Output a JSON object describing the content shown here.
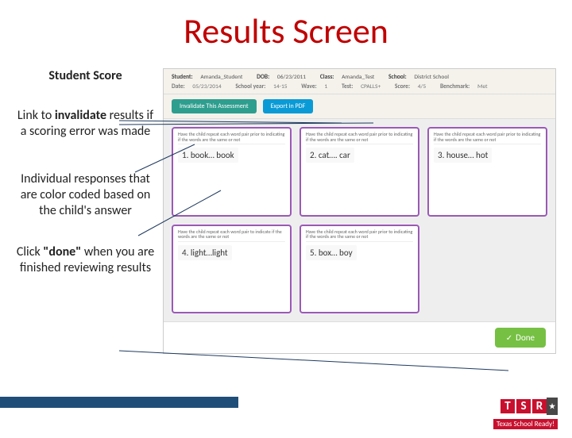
{
  "title": "Results Screen",
  "annotations": {
    "heading": "Student Score",
    "a2_line1": "Link to ",
    "a2_bold": "invalidate",
    "a2_line2": " results if a scoring error was made",
    "a3": "Individual responses that are color coded based on the child's answer",
    "a4_pre": "Click ",
    "a4_bold": "\"done\"",
    "a4_post": " when you are finished reviewing results"
  },
  "app": {
    "header": {
      "student_label": "Student:",
      "student": "Amanda_Student",
      "dob_label": "DOB:",
      "dob": "06/23/2011",
      "class_label": "Class:",
      "class": "Amanda_Test",
      "school_label": "School:",
      "school": "District School",
      "date_label": "Date:",
      "date": "05/23/2014",
      "sy_label": "School year:",
      "sy": "14-15",
      "wave_label": "Wave:",
      "wave": "1",
      "test_label": "Test:",
      "test": "CPALLS+",
      "score_label": "Score:",
      "score": "4/5",
      "bench_label": "Benchmark:",
      "bench": "Met"
    },
    "buttons": {
      "invalidate": "Invalidate This Assessment",
      "export": "Export in PDF",
      "done": "Done"
    },
    "cards": [
      {
        "prompt": "Have the child repeat each word pair prior to indicating if the words are the same or not",
        "answer": "1. book… book"
      },
      {
        "prompt": "Have the child repeat each word pair prior to indicating if the words are the same or not",
        "answer": "2. cat…. car"
      },
      {
        "prompt": "Have the child repeat each word pair prior to indicating if the words are the same or not",
        "answer": "3. house… hot"
      },
      {
        "prompt": "Have the child repeat each word pair to indicate if the words are the same or not",
        "answer": "4. light…light"
      },
      {
        "prompt": "Have the child repeat each word pair prior to indicating if the words are the same or not",
        "answer": "5. box… boy"
      }
    ]
  },
  "brand": {
    "t": "T",
    "s": "S",
    "r": "R",
    "star": "★",
    "tagline": "Texas School Ready!"
  }
}
